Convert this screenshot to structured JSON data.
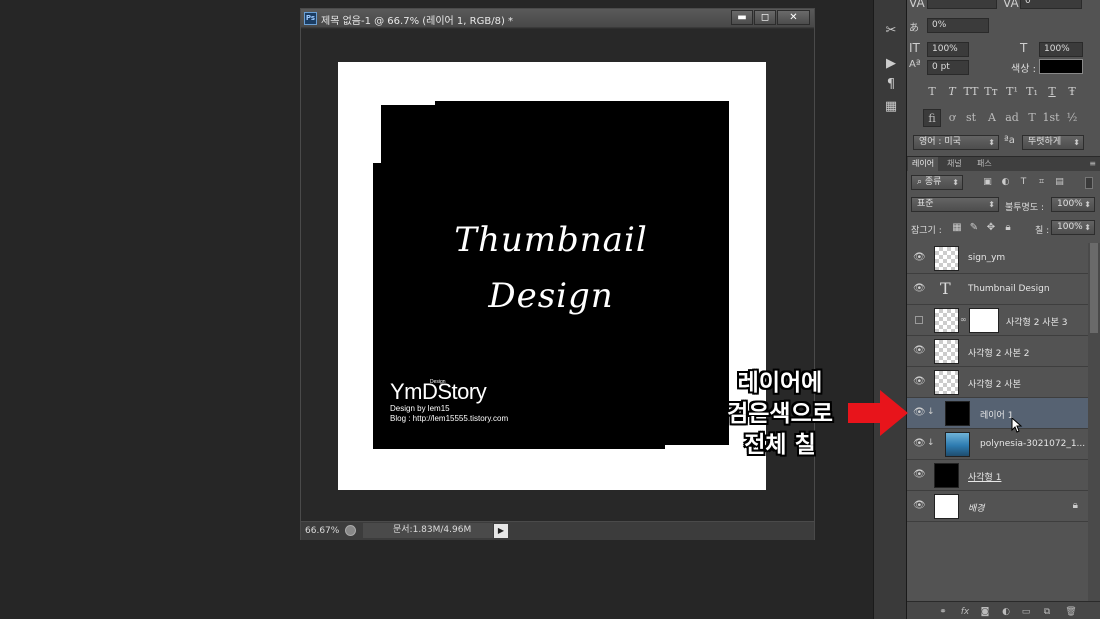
{
  "document": {
    "app_icon": "Ps",
    "title": "제목 없음-1 @ 66.7% (레이어 1, RGB/8) *",
    "window_controls": {
      "minimize": "▬",
      "maximize": "◻",
      "close": "✕"
    },
    "artwork": {
      "title_line1": "Thumbnail",
      "title_line2": "Design",
      "logo_text": "YmDStory",
      "logo_superscript": "Design",
      "byline": "Design by lem15",
      "blog": "Blog : http://lem15555.tistory.com"
    },
    "status": {
      "zoom": "66.67%",
      "doc_info": "문서:1.83M/4.96M",
      "arrow": "▶"
    }
  },
  "tool_strip": {
    "icons": [
      "scissors-icon",
      "play-icon",
      "paragraph-icon",
      "glyph-icon"
    ]
  },
  "character_panel": {
    "tracking": "0",
    "kerning_pct": "0%",
    "vertical_scale": "100%",
    "horizontal_scale": "100%",
    "baseline_shift": "0 pt",
    "color_label": "색상 :",
    "color": "#000000",
    "type_buttons": [
      "T",
      "T",
      "TT",
      "Tт",
      "T¹",
      "T₁",
      "T",
      "Ŧ"
    ],
    "opentype_buttons": [
      "fi",
      "ơ",
      "st",
      "A",
      "ad",
      "T",
      "1st",
      "½"
    ],
    "language": "영어 : 미국",
    "aa_label": "ªa",
    "antialias": "뚜렷하게"
  },
  "layers_panel": {
    "tabs": [
      "레이어",
      "채널",
      "패스"
    ],
    "menu_icon": "≡",
    "filter_kind": "종류",
    "blend_mode": "표준",
    "opacity_label": "불투명도 :",
    "opacity": "100%",
    "lock_label": "잠그기 :",
    "fill_label": "칠 :",
    "fill": "100%",
    "layers": [
      {
        "name": "sign_ym",
        "thumb": "checker",
        "visible": true
      },
      {
        "name": "Thumbnail Design",
        "thumb": "text",
        "visible": true
      },
      {
        "name": "사각형 2 사본 3",
        "thumb": "checker-mask",
        "visible": false
      },
      {
        "name": "사각형 2 사본 2",
        "thumb": "checker",
        "visible": true
      },
      {
        "name": "사각형 2 사본",
        "thumb": "checker",
        "visible": true
      },
      {
        "name": "레이어 1",
        "thumb": "black",
        "visible": true,
        "selected": true,
        "clipped": true
      },
      {
        "name": "polynesia-3021072_1...",
        "thumb": "photo",
        "visible": true,
        "clipped": true
      },
      {
        "name": "사각형 1",
        "thumb": "black",
        "visible": true
      },
      {
        "name": "배경",
        "thumb": "white",
        "visible": true,
        "locked": true
      }
    ],
    "bottom_icons": [
      "link-icon",
      "fx-icon",
      "mask-icon",
      "adjustment-icon",
      "folder-icon",
      "new-layer-icon",
      "trash-icon"
    ]
  },
  "annotation": {
    "line1": "레이어에",
    "line2": "검은색으로",
    "line3": "전체 칠",
    "arrow_color": "#e8141b"
  }
}
